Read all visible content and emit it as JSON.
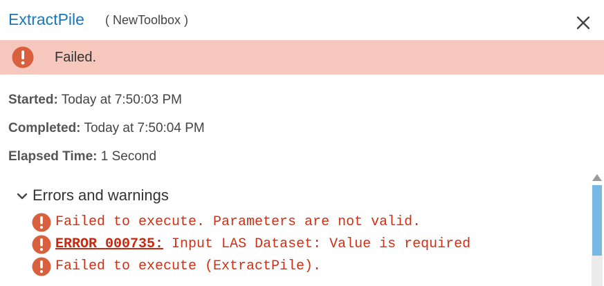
{
  "header": {
    "title": "ExtractPile",
    "subtitle": "( NewToolbox )",
    "close_icon": "close-x-icon"
  },
  "status": {
    "icon": "error-circle-icon",
    "text": "Failed.",
    "background_color": "#f5c7bd",
    "icon_color": "#d9603e"
  },
  "info": {
    "started_label": "Started:",
    "started_value": "Today at 7:50:03 PM",
    "completed_label": "Completed:",
    "completed_value": "Today at 7:50:04 PM",
    "elapsed_label": "Elapsed Time:",
    "elapsed_value": "1 Second"
  },
  "errors_section": {
    "title": "Errors and warnings",
    "expanded": true,
    "messages": [
      {
        "icon": "error-circle-icon",
        "code": "",
        "text": "Failed to execute. Parameters are not valid."
      },
      {
        "icon": "error-circle-icon",
        "code": "ERROR 000735:",
        "text": "Input LAS Dataset: Value is required"
      },
      {
        "icon": "error-circle-icon",
        "code": "",
        "text": "Failed to execute (ExtractPile)."
      }
    ],
    "message_color": "#d22f14"
  },
  "colors": {
    "title": "#1a78b8",
    "scrollbar_thumb": "#78b8e4"
  }
}
